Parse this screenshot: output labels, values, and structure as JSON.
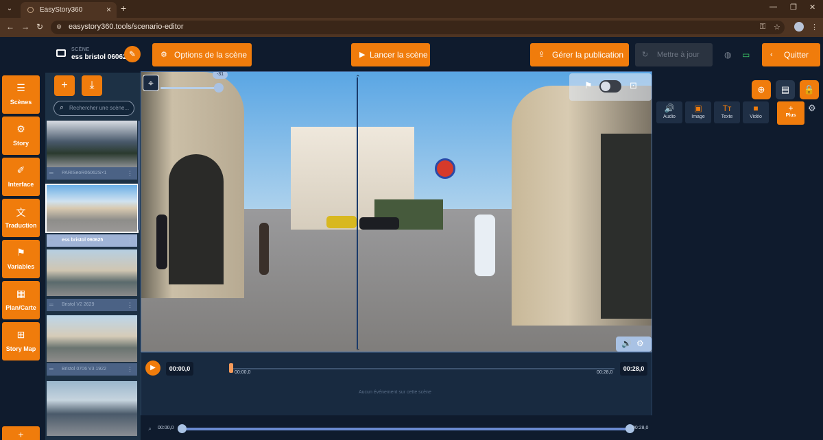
{
  "browser": {
    "tab_title": "EasyStory360",
    "url": "easystory360.tools/scenario-editor"
  },
  "header": {
    "scene_label": "SCÈNE",
    "scene_name": "ess bristol 060625",
    "options_label": "Options de la scène",
    "launch_label": "Lancer la scène",
    "publish_label": "Gérer la publication",
    "disabled_label": "Mettre à jour",
    "quit_label": "Quitter"
  },
  "sidebar": {
    "items": [
      {
        "label": "Scènes",
        "icon": "menu-icon"
      },
      {
        "label": "Story",
        "icon": "gear-icon"
      },
      {
        "label": "Interface",
        "icon": "brush-icon"
      },
      {
        "label": "Traduction",
        "icon": "translate-icon"
      },
      {
        "label": "Variables",
        "icon": "bookmark-icon"
      },
      {
        "label": "Plan/Carte",
        "icon": "map-icon"
      },
      {
        "label": "Story Map",
        "icon": "sitemap-icon"
      }
    ]
  },
  "scenes_panel": {
    "search_placeholder": "Rechercher une scène...",
    "thumbnails": [
      {
        "name": "PARISeoR06062S×1"
      },
      {
        "name": "ess bristol 060625",
        "active": true
      },
      {
        "name": "Bristol V2 2629"
      },
      {
        "name": "Bristol 0706 V3 1922"
      },
      {
        "name": ""
      }
    ]
  },
  "viewer": {
    "slider_value": "-31",
    "slider_fraction": 0.93
  },
  "timeline": {
    "current_time": "00:00,0",
    "total_time": "00:28,0",
    "track_start": "00:00,0",
    "track_end": "00:28,0",
    "empty_message": "Aucun événement sur cette scène",
    "zoom_start": "00:00,0",
    "zoom_end": "00:28,0"
  },
  "right_panel": {
    "media": [
      {
        "label": "Audio",
        "icon": "speaker-icon"
      },
      {
        "label": "Image",
        "icon": "image-icon"
      },
      {
        "label": "Texte",
        "icon": "text-icon"
      },
      {
        "label": "Vidéo",
        "icon": "video-icon"
      }
    ],
    "plus_label": "Plus"
  },
  "colors": {
    "accent": "#f07c0c",
    "background": "#0f1b2d",
    "panel": "#1d3145"
  }
}
